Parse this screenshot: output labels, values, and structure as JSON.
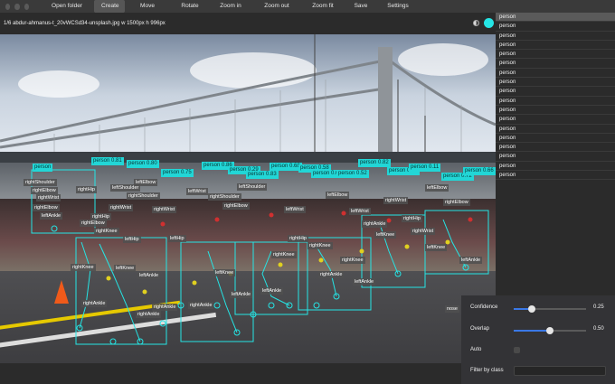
{
  "menu": {
    "items": [
      "Open folder",
      "Create",
      "Move",
      "Rotate",
      "Zoom in",
      "Zoom out",
      "Zoom fit",
      "Save",
      "Settings"
    ],
    "active": "Create"
  },
  "titlebar": {
    "file_info": "1/6 abdur-ahmanus-t_20vWCSd34-unsplash.jpg w 1500px h 996px"
  },
  "colors": {
    "accent": "#25e5e5",
    "detection_label_bg": "#22d6d6",
    "selection_bg": "#5a5a5a"
  },
  "icons": {
    "theme_toggle": "half-circle-icon",
    "color_picker": "color-swatch-icon"
  },
  "image": {
    "detections": [
      {
        "label": "person"
      },
      {
        "label": "person 0.81"
      },
      {
        "label": "person 0.80"
      },
      {
        "label": "person 0.75"
      },
      {
        "label": "person 0.86"
      },
      {
        "label": "person 0.29"
      },
      {
        "label": "person 0.83"
      },
      {
        "label": "person 0.68"
      },
      {
        "label": "person 0.58"
      },
      {
        "label": "person 0.62"
      },
      {
        "label": "person 0.52"
      },
      {
        "label": "person 0.82"
      },
      {
        "label": "person 0.88"
      },
      {
        "label": "person 0.11"
      },
      {
        "label": "person 0.72"
      },
      {
        "label": "person 0.66"
      }
    ],
    "keypoint_labels": [
      {
        "label": "rightShoulder"
      },
      {
        "label": "rightElbow"
      },
      {
        "label": "rightWrist"
      },
      {
        "label": "leftShoulder"
      },
      {
        "label": "rightShoulder"
      },
      {
        "label": "rightElbow"
      },
      {
        "label": "rightHip"
      },
      {
        "label": "leftElbow"
      },
      {
        "label": "leftWrist"
      },
      {
        "label": "rightWrist"
      },
      {
        "label": "rightHip"
      },
      {
        "label": "leftAnkle"
      },
      {
        "label": "rightElbow"
      },
      {
        "label": "rightKnee"
      },
      {
        "label": "leftHip"
      },
      {
        "label": "rightKnee"
      },
      {
        "label": "rightAnkle"
      },
      {
        "label": "leftKnee"
      },
      {
        "label": "leftAnkle"
      },
      {
        "label": "rightAnkle"
      },
      {
        "label": "rightAnkle"
      },
      {
        "label": "leftAnkle"
      },
      {
        "label": "leftKnee"
      },
      {
        "label": "rightKnee"
      },
      {
        "label": "leftAnkle"
      },
      {
        "label": "rightWrist"
      },
      {
        "label": "leftWrist"
      },
      {
        "label": "rightKnee"
      },
      {
        "label": "rightAnkle"
      },
      {
        "label": "leftKnee"
      },
      {
        "label": "rightHip"
      },
      {
        "label": "rightElbow"
      },
      {
        "label": "leftElbow"
      },
      {
        "label": "rightWrist"
      },
      {
        "label": "leftShoulder"
      },
      {
        "label": "rightShoulder"
      },
      {
        "label": "leftElbow"
      },
      {
        "label": "rightElbow"
      },
      {
        "label": "leftKnee"
      },
      {
        "label": "leftAnkle"
      },
      {
        "label": "rightKnee"
      },
      {
        "label": "rightAnkle"
      },
      {
        "label": "leftHip"
      },
      {
        "label": "rightHip"
      },
      {
        "label": "leftWrist"
      },
      {
        "label": "rightWrist"
      },
      {
        "label": "leftAnkle"
      },
      {
        "label": "rightAnkle"
      }
    ],
    "nose_label": "nose"
  },
  "list": {
    "items": [
      "person",
      "person",
      "person",
      "person",
      "person",
      "person",
      "person",
      "person",
      "person",
      "person",
      "person",
      "person",
      "person",
      "person",
      "person",
      "person",
      "person",
      "person"
    ],
    "selected_index": 0
  },
  "settings": {
    "confidence": {
      "label": "Confidence",
      "value": "0.25",
      "fraction": 0.25
    },
    "overlap": {
      "label": "Overlap",
      "value": "0.50",
      "fraction": 0.5
    },
    "auto": {
      "label": "Auto",
      "checked": false
    },
    "filter": {
      "label": "Filter by class",
      "value": ""
    }
  }
}
